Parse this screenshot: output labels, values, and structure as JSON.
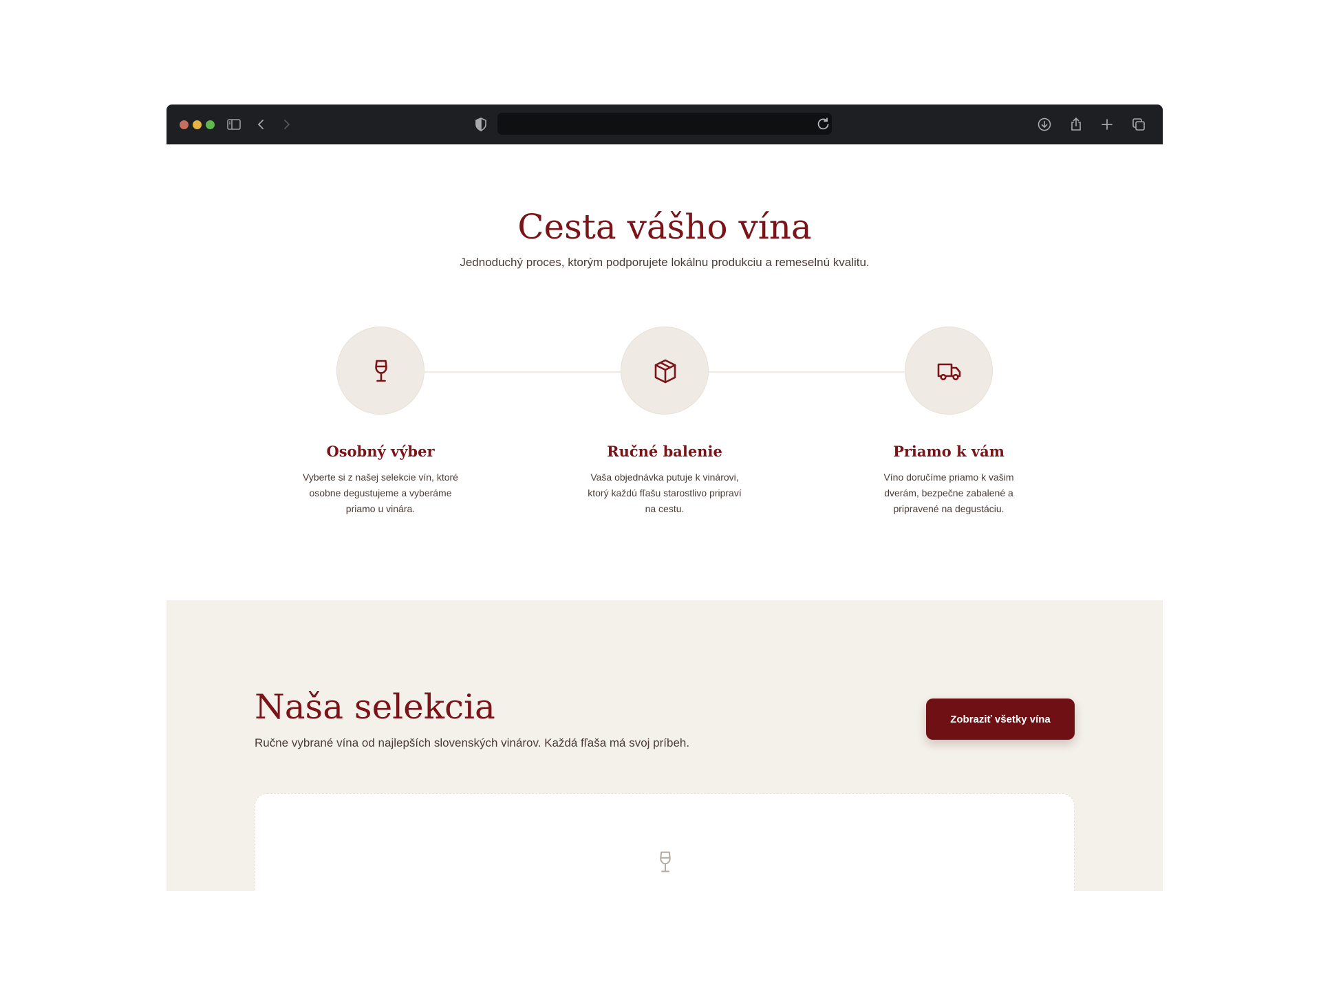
{
  "browser": {
    "traffic_lights": {
      "close": "#c66e5f",
      "minimize": "#e7b343",
      "maximize": "#5cb94e"
    },
    "icons": [
      "sidebar-icon",
      "back-icon",
      "forward-icon",
      "shield-icon",
      "reload-icon",
      "download-icon",
      "share-icon",
      "new-tab-icon",
      "tabs-icon"
    ],
    "url": ""
  },
  "process": {
    "title": "Cesta vášho vína",
    "subtitle": "Jednoduchý proces, ktorým podporujete lokálnu produkciu a remeselnú kvalitu.",
    "steps": [
      {
        "icon": "wine-glass-icon",
        "title": "Osobný výber",
        "text": "Vyberte si z našej selekcie vín, ktoré osobne degustujeme a vyberáme priamo u vinára."
      },
      {
        "icon": "package-icon",
        "title": "Ručné balenie",
        "text": "Vaša objednávka putuje k vinárovi, ktorý každú fľašu starostlivo pripraví na cestu."
      },
      {
        "icon": "truck-icon",
        "title": "Priamo k vám",
        "text": "Víno doručíme priamo k vašim dverám, bezpečne zabalené a pripravené na degustáciu."
      }
    ]
  },
  "selection": {
    "title": "Naša selekcia",
    "subtitle": "Ručne vybrané vína od najlepších slovenských vinárov. Každá fľaša má svoj príbeh.",
    "cta_label": "Zobraziť všetky vína",
    "empty_icon": "wine-glass-icon",
    "empty_text": ""
  },
  "colors": {
    "accent": "#7a1418",
    "button": "#6f1114",
    "band": "#f4f1ea",
    "circle": "#efebe4",
    "body_text": "#4a3b36"
  }
}
